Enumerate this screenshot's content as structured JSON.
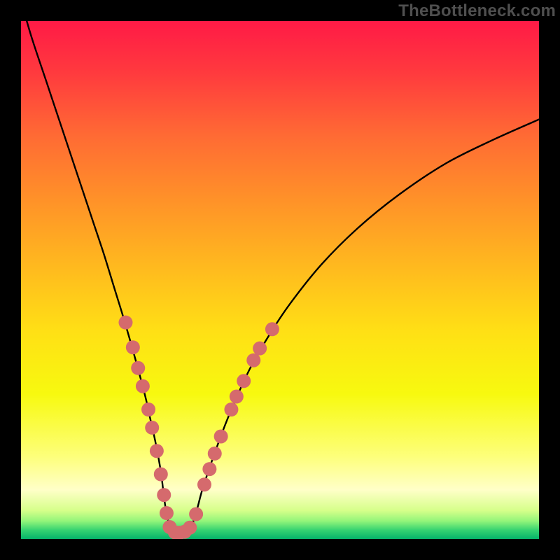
{
  "watermark": "TheBottleneck.com",
  "chart_data": {
    "type": "line",
    "title": "",
    "xlabel": "",
    "ylabel": "",
    "xlim": [
      0,
      100
    ],
    "ylim": [
      0,
      100
    ],
    "grid": false,
    "legend": false,
    "series": [
      {
        "name": "curve",
        "x": [
          0,
          2,
          5,
          8,
          11,
          14,
          16,
          18,
          20,
          22,
          24,
          25,
          26,
          27,
          27.5,
          28,
          28.8,
          30,
          31.5,
          33,
          34,
          35,
          37,
          40,
          44,
          48,
          52,
          58,
          65,
          73,
          82,
          91,
          100
        ],
        "y": [
          104,
          97,
          88,
          79,
          70,
          61,
          55,
          48.5,
          42,
          35,
          27.5,
          23,
          18.5,
          13,
          9,
          5.5,
          2.2,
          1.2,
          1.2,
          2.8,
          5.8,
          9.5,
          15.5,
          23.5,
          32.5,
          39.5,
          45.5,
          53,
          60,
          66.5,
          72.5,
          77,
          81
        ]
      }
    ],
    "dots": [
      {
        "x": 20.2,
        "y": 41.8
      },
      {
        "x": 21.6,
        "y": 37.0
      },
      {
        "x": 22.6,
        "y": 33.0
      },
      {
        "x": 23.5,
        "y": 29.5
      },
      {
        "x": 24.6,
        "y": 25.0
      },
      {
        "x": 25.3,
        "y": 21.5
      },
      {
        "x": 26.2,
        "y": 17.0
      },
      {
        "x": 27.0,
        "y": 12.5
      },
      {
        "x": 27.6,
        "y": 8.5
      },
      {
        "x": 28.1,
        "y": 5.0
      },
      {
        "x": 28.7,
        "y": 2.3
      },
      {
        "x": 29.7,
        "y": 1.3
      },
      {
        "x": 30.6,
        "y": 1.2
      },
      {
        "x": 31.6,
        "y": 1.4
      },
      {
        "x": 32.6,
        "y": 2.2
      },
      {
        "x": 33.8,
        "y": 4.8
      },
      {
        "x": 35.4,
        "y": 10.5
      },
      {
        "x": 36.4,
        "y": 13.5
      },
      {
        "x": 37.4,
        "y": 16.5
      },
      {
        "x": 38.6,
        "y": 19.8
      },
      {
        "x": 40.6,
        "y": 25.0
      },
      {
        "x": 41.6,
        "y": 27.5
      },
      {
        "x": 43.0,
        "y": 30.5
      },
      {
        "x": 44.9,
        "y": 34.5
      },
      {
        "x": 46.1,
        "y": 36.8
      },
      {
        "x": 48.5,
        "y": 40.5
      }
    ],
    "gradient_stops": [
      {
        "offset": 0.0,
        "color": "#ff1a46"
      },
      {
        "offset": 0.1,
        "color": "#ff3a3e"
      },
      {
        "offset": 0.22,
        "color": "#ff6a34"
      },
      {
        "offset": 0.35,
        "color": "#ff9328"
      },
      {
        "offset": 0.48,
        "color": "#ffbb1e"
      },
      {
        "offset": 0.6,
        "color": "#ffe015"
      },
      {
        "offset": 0.72,
        "color": "#f7f90f"
      },
      {
        "offset": 0.84,
        "color": "#fdff7a"
      },
      {
        "offset": 0.905,
        "color": "#ffffc8"
      },
      {
        "offset": 0.945,
        "color": "#d6ff8a"
      },
      {
        "offset": 0.965,
        "color": "#94f57a"
      },
      {
        "offset": 0.983,
        "color": "#35d271"
      },
      {
        "offset": 1.0,
        "color": "#05b36a"
      }
    ],
    "dot_color": "#d56a6d",
    "dot_radius": 10
  }
}
